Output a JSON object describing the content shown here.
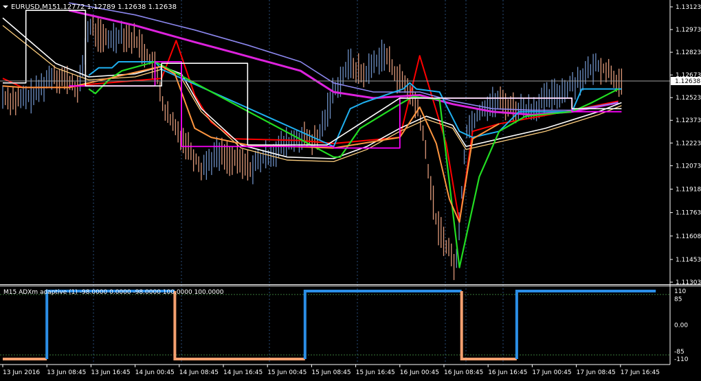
{
  "header": {
    "symbol": "EURUSD,M15",
    "ohlc": "1.12772 1.12789 1.12638 1.12638"
  },
  "price_scale": {
    "ticks": [
      "1.13123",
      "1.12973",
      "1.12823",
      "1.12673",
      "1.12523",
      "1.12373",
      "1.12223",
      "1.12073",
      "1.11918",
      "1.11763",
      "1.11608",
      "1.11453",
      "1.11303"
    ],
    "current_price": "1.12638"
  },
  "time_axis": {
    "labels": [
      "13 Jun 2016",
      "13 Jun 08:45",
      "13 Jun 16:45",
      "14 Jun 00:45",
      "14 Jun 08:45",
      "14 Jun 16:45",
      "15 Jun 00:45",
      "15 Jun 08:45",
      "15 Jun 16:45",
      "16 Jun 00:45",
      "16 Jun 08:45",
      "16 Jun 16:45",
      "17 Jun 00:45",
      "17 Jun 08:45",
      "17 Jun 16:45"
    ]
  },
  "colors": {
    "bg": "#000000",
    "axis": "#ffffff",
    "grid_sep": "#2a4e7a",
    "bull_bars": "#6d8fc4",
    "bear_bars": "#e09a7a",
    "ma_red": "#ff0000",
    "ma_magenta_thick": "#dd22dd",
    "ma_lavender": "#8c87ee",
    "ma_white": "#ffffff",
    "ma_cyan": "#1fb0f0",
    "ma_green": "#22dd22",
    "ma_tan": "#ffcf7e",
    "ma_orange": "#ff9640",
    "ma_step_magenta": "#ff00ff",
    "adx_up": "#2b8ee6",
    "adx_down": "#f4a070",
    "level_line": "#3a7a3a"
  },
  "indicator": {
    "label": "M15 ADXm adaptive (1) -98.0000 0.0000 -98.0000 100.0000 100.0000",
    "ticks": [
      "110",
      "85",
      "0.00",
      "-85",
      "-110"
    ]
  },
  "chart_data": [
    {
      "type": "line",
      "title": "EURUSD,M15",
      "y_range": [
        1.11303,
        1.13123
      ],
      "x_labels": [
        "13 Jun 2016",
        "13 Jun 08:45",
        "13 Jun 16:45",
        "14 Jun 00:45",
        "14 Jun 08:45",
        "14 Jun 16:45",
        "15 Jun 00:45",
        "15 Jun 08:45",
        "15 Jun 16:45",
        "16 Jun 00:45",
        "16 Jun 08:45",
        "16 Jun 16:45",
        "17 Jun 00:45",
        "17 Jun 08:45",
        "17 Jun 16:45"
      ],
      "last_price": 1.12638,
      "price_series": [
        [
          0,
          1.1253
        ],
        [
          0.25,
          1.125
        ],
        [
          0.5,
          1.1255
        ],
        [
          0.75,
          1.1268
        ],
        [
          1.0,
          1.1263
        ],
        [
          1.15,
          1.1257
        ],
        [
          1.3,
          1.13
        ],
        [
          1.55,
          1.129
        ],
        [
          1.8,
          1.1295
        ],
        [
          2.05,
          1.1289
        ],
        [
          2.3,
          1.1272
        ],
        [
          2.45,
          1.1243
        ],
        [
          2.6,
          1.1232
        ],
        [
          2.75,
          1.1224
        ],
        [
          3.0,
          1.1206
        ],
        [
          3.25,
          1.1216
        ],
        [
          3.5,
          1.1211
        ],
        [
          3.75,
          1.1206
        ],
        [
          4.0,
          1.1214
        ],
        [
          4.25,
          1.1221
        ],
        [
          4.5,
          1.1226
        ],
        [
          4.75,
          1.1223
        ],
        [
          5.0,
          1.1257
        ],
        [
          5.25,
          1.1275
        ],
        [
          5.45,
          1.1267
        ],
        [
          5.75,
          1.1282
        ],
        [
          6.0,
          1.1264
        ],
        [
          6.15,
          1.1256
        ],
        [
          6.3,
          1.1241
        ],
        [
          6.55,
          1.117
        ],
        [
          6.85,
          1.114
        ],
        [
          7.0,
          1.123
        ],
        [
          7.25,
          1.1246
        ],
        [
          7.5,
          1.125
        ],
        [
          7.75,
          1.1245
        ],
        [
          8.0,
          1.1245
        ],
        [
          8.25,
          1.1252
        ],
        [
          8.5,
          1.1258
        ],
        [
          8.75,
          1.1266
        ],
        [
          9.0,
          1.1274
        ],
        [
          9.2,
          1.1268
        ],
        [
          9.35,
          1.126
        ]
      ],
      "series": [
        {
          "color": "#ff0000",
          "values": [
            [
              0,
              1.1265
            ],
            [
              0.3,
              1.1259
            ],
            [
              1.0,
              1.1259
            ],
            [
              1.3,
              1.1261
            ],
            [
              2.4,
              1.1265
            ],
            [
              2.62,
              1.129
            ],
            [
              2.9,
              1.1254
            ],
            [
              3.15,
              1.1236
            ],
            [
              3.5,
              1.1225
            ],
            [
              4.5,
              1.1224
            ],
            [
              5.0,
              1.1222
            ],
            [
              6.0,
              1.1226
            ],
            [
              6.3,
              1.128
            ],
            [
              6.7,
              1.1222
            ],
            [
              6.9,
              1.117
            ],
            [
              7.1,
              1.123
            ],
            [
              7.5,
              1.1235
            ],
            [
              8.5,
              1.1243
            ],
            [
              9.3,
              1.125
            ]
          ]
        },
        {
          "color": "#dd22dd",
          "values": [
            [
              1.0,
              1.131
            ],
            [
              2.0,
              1.13
            ],
            [
              2.9,
              1.1289
            ],
            [
              3.5,
              1.1282
            ],
            [
              4.5,
              1.127
            ],
            [
              5.0,
              1.1256
            ],
            [
              5.6,
              1.1252
            ],
            [
              6.3,
              1.1254
            ],
            [
              6.8,
              1.1248
            ],
            [
              7.4,
              1.1243
            ],
            [
              8.0,
              1.1241
            ],
            [
              8.6,
              1.1243
            ],
            [
              9.3,
              1.1249
            ]
          ]
        },
        {
          "color": "#8c87ee",
          "values": [
            [
              1.0,
              1.1315
            ],
            [
              2.0,
              1.1307
            ],
            [
              2.9,
              1.1297
            ],
            [
              3.7,
              1.1287
            ],
            [
              4.5,
              1.1276
            ],
            [
              5.0,
              1.1262
            ],
            [
              5.6,
              1.1256
            ],
            [
              6.3,
              1.1256
            ],
            [
              6.8,
              1.125
            ],
            [
              7.4,
              1.1245
            ],
            [
              8.0,
              1.1244
            ],
            [
              8.6,
              1.1244
            ],
            [
              9.3,
              1.1249
            ]
          ]
        },
        {
          "color": "#ffffff",
          "values": [
            [
              0,
              1.1305
            ],
            [
              0.4,
              1.129
            ],
            [
              0.8,
              1.1275
            ],
            [
              1.3,
              1.1266
            ],
            [
              2.0,
              1.1268
            ],
            [
              2.4,
              1.1273
            ],
            [
              2.7,
              1.1268
            ],
            [
              3.0,
              1.1245
            ],
            [
              3.6,
              1.1221
            ],
            [
              4.3,
              1.1213
            ],
            [
              5.0,
              1.1212
            ],
            [
              5.5,
              1.122
            ],
            [
              6.0,
              1.1232
            ],
            [
              6.4,
              1.124
            ],
            [
              6.8,
              1.1234
            ],
            [
              7.0,
              1.122
            ],
            [
              7.5,
              1.1225
            ],
            [
              8.2,
              1.1232
            ],
            [
              9.0,
              1.1243
            ],
            [
              9.35,
              1.1249
            ]
          ]
        },
        {
          "color": "#ffcf7e",
          "values": [
            [
              0,
              1.13
            ],
            [
              0.4,
              1.1286
            ],
            [
              0.8,
              1.1272
            ],
            [
              1.3,
              1.1264
            ],
            [
              2.0,
              1.1266
            ],
            [
              2.4,
              1.1271
            ],
            [
              2.7,
              1.1265
            ],
            [
              3.0,
              1.1243
            ],
            [
              3.6,
              1.1219
            ],
            [
              4.3,
              1.1211
            ],
            [
              5.0,
              1.121
            ],
            [
              5.5,
              1.1218
            ],
            [
              6.0,
              1.123
            ],
            [
              6.4,
              1.1238
            ],
            [
              6.8,
              1.1232
            ],
            [
              7.0,
              1.1218
            ],
            [
              7.5,
              1.1223
            ],
            [
              8.2,
              1.123
            ],
            [
              9.0,
              1.1241
            ],
            [
              9.35,
              1.1247
            ]
          ]
        },
        {
          "color": "#1fb0f0",
          "values": [
            [
              1.3,
              1.1267
            ],
            [
              1.45,
              1.1272
            ],
            [
              1.65,
              1.1272
            ],
            [
              1.75,
              1.1276
            ],
            [
              2.3,
              1.1276
            ],
            [
              2.4,
              1.1271
            ],
            [
              5.0,
              1.122
            ],
            [
              5.25,
              1.1245
            ],
            [
              5.45,
              1.1249
            ],
            [
              6.05,
              1.1258
            ],
            [
              6.15,
              1.1262
            ],
            [
              6.25,
              1.1258
            ],
            [
              6.6,
              1.1256
            ],
            [
              6.9,
              1.123
            ],
            [
              7.1,
              1.1226
            ],
            [
              7.5,
              1.123
            ],
            [
              7.8,
              1.1243
            ],
            [
              8.6,
              1.1243
            ],
            [
              8.75,
              1.1258
            ],
            [
              9.35,
              1.1258
            ]
          ]
        },
        {
          "color": "#22dd22",
          "values": [
            [
              1.3,
              1.1258
            ],
            [
              1.4,
              1.1255
            ],
            [
              1.6,
              1.1264
            ],
            [
              1.8,
              1.127
            ],
            [
              2.3,
              1.1276
            ],
            [
              5.0,
              1.1213
            ],
            [
              5.1,
              1.1213
            ],
            [
              5.4,
              1.1232
            ],
            [
              5.7,
              1.124
            ],
            [
              6.0,
              1.1248
            ],
            [
              6.2,
              1.1253
            ],
            [
              6.6,
              1.1251
            ],
            [
              6.9,
              1.114
            ],
            [
              7.2,
              1.12
            ],
            [
              7.5,
              1.123
            ],
            [
              7.9,
              1.124
            ],
            [
              8.6,
              1.1243
            ],
            [
              8.9,
              1.1249
            ],
            [
              9.3,
              1.1258
            ]
          ]
        },
        {
          "color": "#ff9640",
          "values": [
            [
              0,
              1.126
            ],
            [
              0.3,
              1.1259
            ],
            [
              1.0,
              1.1259
            ],
            [
              1.3,
              1.1262
            ],
            [
              2.4,
              1.1273
            ],
            [
              2.6,
              1.1268
            ],
            [
              2.9,
              1.1232
            ],
            [
              3.15,
              1.1226
            ],
            [
              3.7,
              1.1221
            ],
            [
              5.0,
              1.1219
            ],
            [
              6.0,
              1.1226
            ],
            [
              6.3,
              1.1246
            ],
            [
              6.55,
              1.1222
            ],
            [
              6.75,
              1.1185
            ],
            [
              6.9,
              1.117
            ],
            [
              7.1,
              1.1225
            ],
            [
              7.5,
              1.1235
            ]
          ]
        },
        {
          "color": "#ff00ff",
          "values": [
            [
              1.0,
              1.126
            ],
            [
              2.3,
              1.126
            ],
            [
              2.3,
              1.1276
            ],
            [
              2.7,
              1.1276
            ],
            [
              2.7,
              1.122
            ],
            [
              5.0,
              1.122
            ],
            [
              5.0,
              1.1219
            ],
            [
              6.0,
              1.1219
            ],
            [
              6.0,
              1.1252
            ],
            [
              8.6,
              1.1252
            ],
            [
              8.6,
              1.1243
            ],
            [
              9.35,
              1.1243
            ]
          ]
        },
        {
          "color": "#ffffff",
          "values": [
            [
              0,
              1.1262
            ],
            [
              0.35,
              1.1262
            ],
            [
              0.35,
              1.131
            ],
            [
              1.25,
              1.131
            ],
            [
              1.25,
              1.126
            ],
            [
              2.4,
              1.126
            ],
            [
              2.4,
              1.1275
            ],
            [
              3.7,
              1.1275
            ],
            [
              3.7,
              1.1221
            ],
            [
              4.9,
              1.1221
            ],
            [
              4.9,
              1.1221
            ],
            [
              6.0,
              1.1252
            ],
            [
              8.6,
              1.1252
            ],
            [
              8.6,
              1.1245
            ],
            [
              9.35,
              1.1245
            ]
          ]
        }
      ]
    },
    {
      "type": "line",
      "title": "M15 ADXm adaptive (1) -98.0000 0.0000 -98.0000 100.0000 100.0000",
      "y_range": [
        -110,
        110
      ],
      "levels": [
        85,
        -85
      ],
      "series": [
        {
          "color": "#f4a070",
          "values": [
            [
              0,
              -110
            ],
            [
              1.0,
              -110
            ]
          ]
        },
        {
          "color": "#2b8ee6",
          "values": [
            [
              1.0,
              -110
            ],
            [
              1.0,
              110
            ],
            [
              3.9,
              110
            ]
          ]
        },
        {
          "color": "#f4a070",
          "values": [
            [
              3.9,
              110
            ],
            [
              3.9,
              -110
            ],
            [
              6.85,
              -110
            ]
          ]
        },
        {
          "color": "#2b8ee6",
          "values": [
            [
              6.85,
              -110
            ],
            [
              6.85,
              110
            ],
            [
              10.4,
              110
            ]
          ]
        },
        {
          "color": "#f4a070",
          "values": [
            [
              10.4,
              110
            ],
            [
              10.4,
              -110
            ],
            [
              11.65,
              -110
            ]
          ]
        },
        {
          "color": "#2b8ee6",
          "values": [
            [
              11.65,
              -110
            ],
            [
              11.65,
              110
            ],
            [
              14.8,
              110
            ]
          ]
        }
      ]
    }
  ]
}
